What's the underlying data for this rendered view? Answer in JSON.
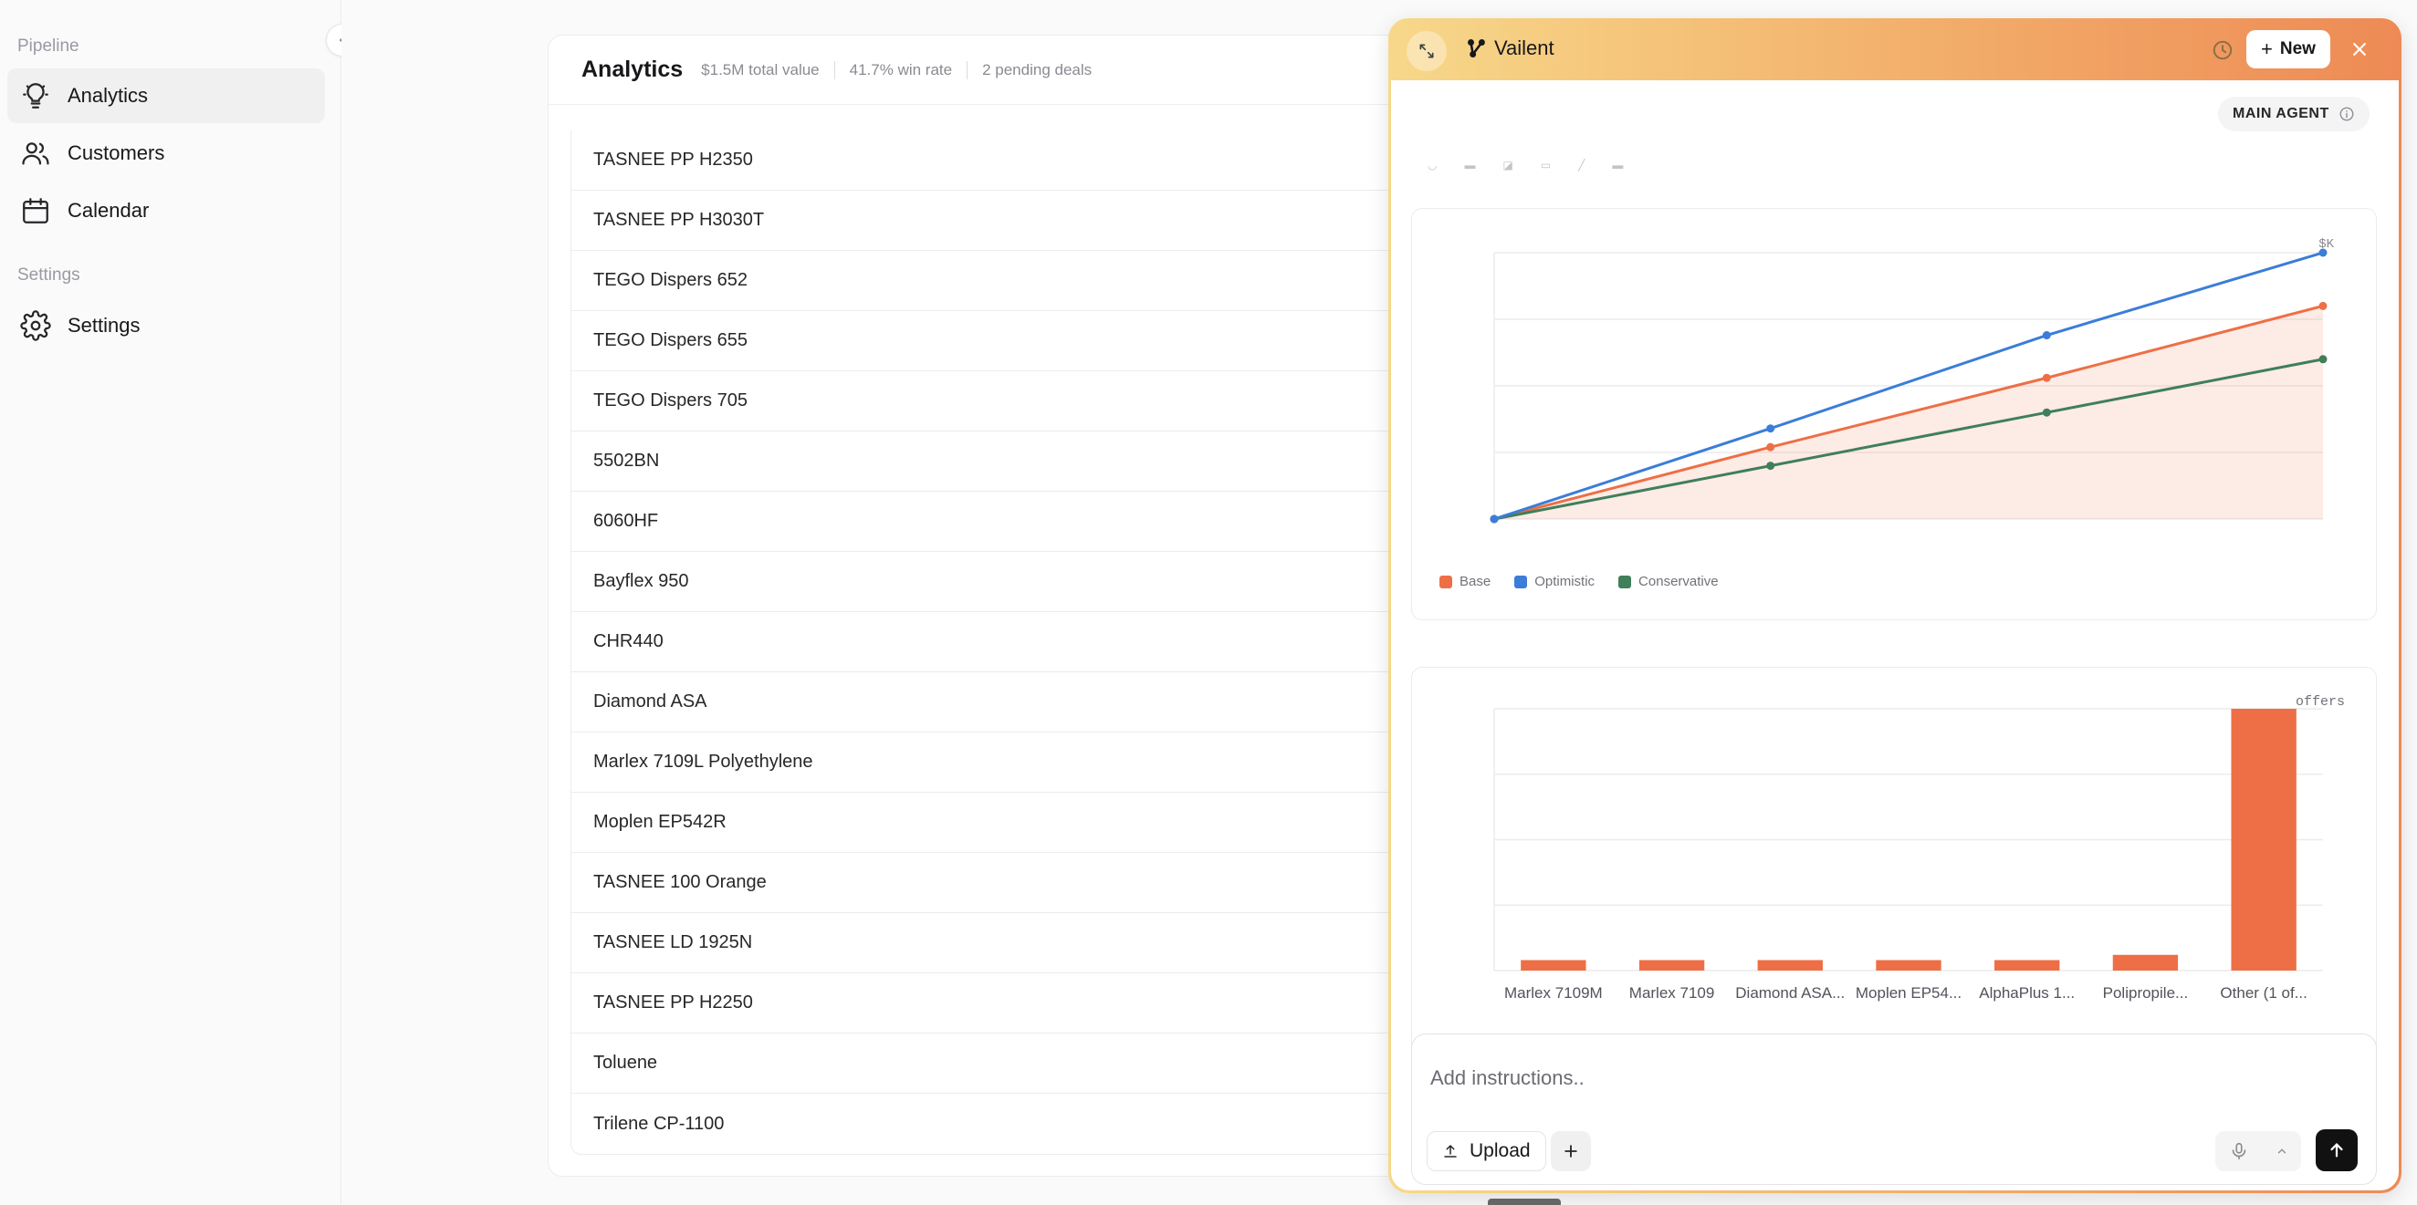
{
  "sidebar": {
    "groups": [
      {
        "label": "Pipeline"
      },
      {
        "label": "Settings"
      }
    ],
    "items": [
      {
        "label": "Analytics"
      },
      {
        "label": "Customers"
      },
      {
        "label": "Calendar"
      },
      {
        "label": "Settings"
      }
    ]
  },
  "header": {
    "title": "Analytics",
    "total_value": "$1.5M total value",
    "win_rate": "41.7% win rate",
    "pending": "2 pending deals"
  },
  "products": [
    "TASNEE PP H2350",
    "TASNEE PP H3030T",
    "TEGO Dispers 652",
    "TEGO Dispers 655",
    "TEGO Dispers 705",
    "5502BN",
    "6060HF",
    "Bayflex 950",
    "CHR440",
    "Diamond ASA",
    "Marlex 7109L Polyethylene",
    "Moplen EP542R",
    "TASNEE 100 Orange",
    "TASNEE LD 1925N",
    "TASNEE PP H2250",
    "Toluene",
    "Trilene CP-1100"
  ],
  "agent": {
    "brand": "Vailent",
    "new_label": "New",
    "badge": "MAIN AGENT",
    "composer_placeholder": "Add instructions..",
    "upload_label": "Upload"
  },
  "colors": {
    "base": "#ee6f45",
    "optimistic": "#3b7dd8",
    "conservative": "#3f7f5a",
    "bar": "#ee6f45"
  },
  "chart_data": [
    {
      "type": "line",
      "y_unit_label": "$K",
      "x": [
        0,
        1,
        2,
        3
      ],
      "ylim": [
        0,
        100
      ],
      "grid": true,
      "legend": "bottom-left",
      "series": [
        {
          "name": "Base",
          "values": [
            0,
            27,
            53,
            80
          ],
          "color": "#ee6f45",
          "fill": true
        },
        {
          "name": "Optimistic",
          "values": [
            0,
            34,
            69,
            100
          ],
          "color": "#3b7dd8"
        },
        {
          "name": "Conservative",
          "values": [
            0,
            20,
            40,
            60
          ],
          "color": "#3f7f5a"
        }
      ]
    },
    {
      "type": "bar",
      "y_unit_label": "offers",
      "categories": [
        "Marlex 7109M",
        "Marlex 7109",
        "Diamond ASA...",
        "Moplen EP54...",
        "AlphaPlus 1...",
        "Polipropile...",
        "Other (1 of..."
      ],
      "values": [
        1,
        1,
        1,
        1,
        1,
        1.5,
        25
      ],
      "ylim": [
        0,
        25
      ],
      "grid": true,
      "color": "#ee6f45"
    }
  ]
}
